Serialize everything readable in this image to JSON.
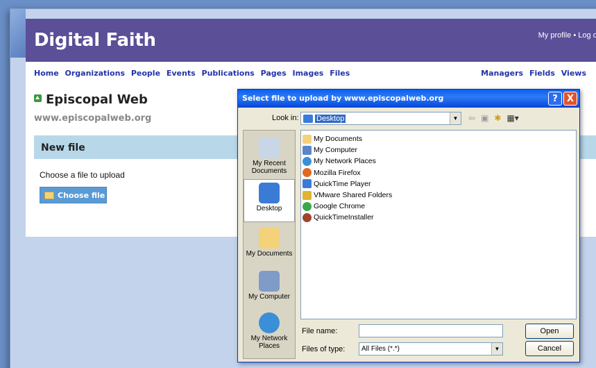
{
  "site": {
    "title": "Digital Faith",
    "user_links": {
      "profile": "My profile",
      "separator": "•",
      "logout": "Log out"
    }
  },
  "nav": {
    "left": [
      "Home",
      "Organizations",
      "People",
      "Events",
      "Publications",
      "Pages",
      "Images",
      "Files"
    ],
    "right": [
      "Managers",
      "Fields",
      "Views"
    ]
  },
  "org": {
    "title": "Episcopal Web",
    "url": "www.episcopalweb.org"
  },
  "section": {
    "title": "New file",
    "instruction": "Choose a file to upload",
    "button_label": "Choose file"
  },
  "dialog": {
    "title": "Select file to upload by www.episcopalweb.org",
    "help_label": "?",
    "close_label": "X",
    "look_in_label": "Look in:",
    "look_in_value": "Desktop",
    "places": [
      {
        "label": "My Recent Documents",
        "icon": "recent-docs-icon"
      },
      {
        "label": "Desktop",
        "icon": "desktop-icon"
      },
      {
        "label": "My Documents",
        "icon": "my-documents-icon"
      },
      {
        "label": "My Computer",
        "icon": "my-computer-icon"
      },
      {
        "label": "My Network Places",
        "icon": "network-places-icon"
      }
    ],
    "files": [
      {
        "name": "My Documents",
        "icon": "folder-icon",
        "color": "#f3d27a"
      },
      {
        "name": "My Computer",
        "icon": "computer-icon",
        "color": "#5a86c8"
      },
      {
        "name": "My Network Places",
        "icon": "network-icon",
        "color": "#3b8fd6"
      },
      {
        "name": "Mozilla Firefox",
        "icon": "firefox-icon",
        "color": "#e06a1f"
      },
      {
        "name": "QuickTime Player",
        "icon": "quicktime-icon",
        "color": "#3b7bd6"
      },
      {
        "name": "VMware Shared Folders",
        "icon": "vmware-folder-icon",
        "color": "#e0b430"
      },
      {
        "name": "Google Chrome",
        "icon": "chrome-icon",
        "color": "#3aa84a"
      },
      {
        "name": "QuickTimeInstaller",
        "icon": "installer-icon",
        "color": "#a0452a"
      }
    ],
    "file_name_label": "File name:",
    "file_name_value": "",
    "file_type_label": "Files of type:",
    "file_type_value": "All Files (*.*)",
    "open_label": "Open",
    "cancel_label": "Cancel"
  }
}
